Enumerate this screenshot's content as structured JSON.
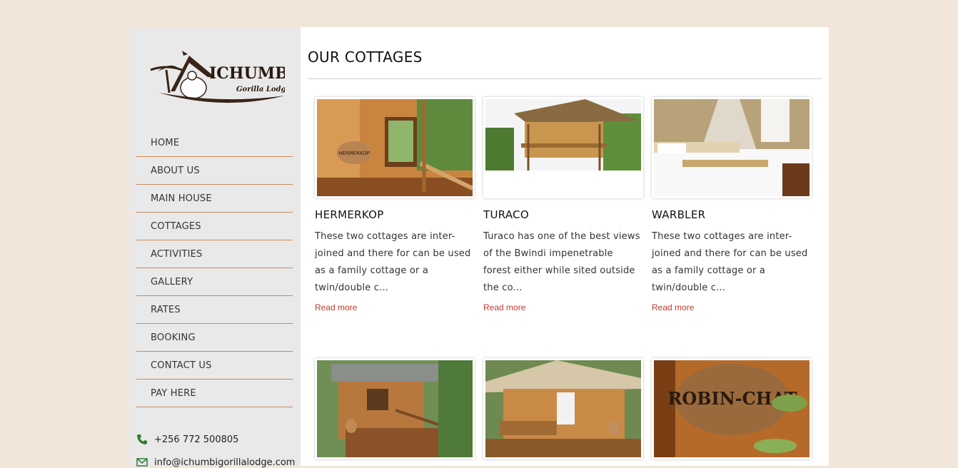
{
  "logo": {
    "brand": "ICHUMBI",
    "tagline": "Gorilla Lodge"
  },
  "nav": [
    {
      "label": "HOME"
    },
    {
      "label": "ABOUT US"
    },
    {
      "label": "MAIN HOUSE"
    },
    {
      "label": "COTTAGES"
    },
    {
      "label": "ACTIVITIES"
    },
    {
      "label": "GALLERY"
    },
    {
      "label": "RATES"
    },
    {
      "label": "BOOKING"
    },
    {
      "label": "CONTACT US"
    },
    {
      "label": "PAY HERE"
    }
  ],
  "contact": {
    "phone": "+256 772 500805",
    "email": "info@ichumbigorillalodge.com",
    "phone_icon": "phone-icon",
    "email_icon": "envelope-icon"
  },
  "page": {
    "title": "OUR COTTAGES"
  },
  "cottages": [
    {
      "name": "HERMERKOP",
      "desc": "These two cottages are inter-joined and there for can be used as a family cottage or a twin/double c...",
      "link": "Read more",
      "sign": "HERMERKOP"
    },
    {
      "name": "TURACO",
      "desc": "Turaco has one of the best views of the Bwindi impenetrable forest either while sited outside the co...",
      "link": "Read more"
    },
    {
      "name": "WARBLER",
      "desc": "These two cottages are inter-joined and there for can be used as a family cottage or a twin/double c...",
      "link": "Read more"
    },
    {
      "name": "",
      "desc": "",
      "link": ""
    },
    {
      "name": "",
      "desc": "",
      "link": ""
    },
    {
      "name": "",
      "desc": "",
      "link": "",
      "sign": "ROBIN-CHAT"
    }
  ],
  "colors": {
    "accent": "#c0392b",
    "divider": "#c98a5a",
    "page_bg": "#f2e5da",
    "sidebar_bg": "#e9e9e9"
  }
}
